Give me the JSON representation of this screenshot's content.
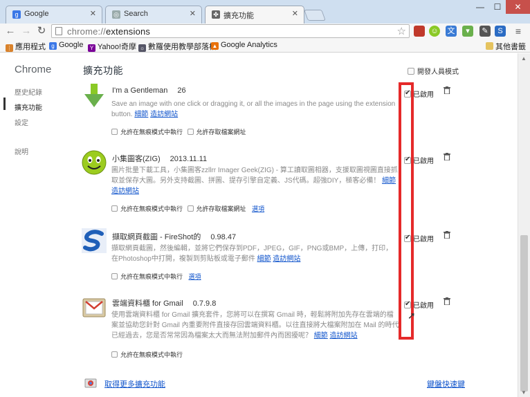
{
  "tabs": [
    {
      "title": "Google",
      "icon": "google-g-icon",
      "color": "#3b78e7"
    },
    {
      "title": "Search",
      "icon": "search-icon",
      "color": "#888888"
    },
    {
      "title": "擴充功能",
      "icon": "puzzle-icon",
      "color": "#555555"
    }
  ],
  "window_controls": {
    "minimize": "—",
    "maximize": "☐",
    "close": "✕"
  },
  "toolbar": {
    "url_scheme": "chrome://",
    "url_path": "extensions"
  },
  "bookmarks": [
    {
      "label": "應用程式",
      "icon": "apps-grid-icon"
    },
    {
      "label": "Google",
      "icon": "google-icon"
    },
    {
      "label": "Yahoo!奇摩",
      "icon": "yahoo-icon"
    },
    {
      "label": "數羅使用教學部落格",
      "icon": "blog-icon"
    },
    {
      "label": "Google Analytics",
      "icon": "analytics-icon"
    }
  ],
  "other_bookmarks": "其他書籤",
  "sidebar": {
    "brand": "Chrome",
    "items": [
      {
        "label": "歷史紀錄"
      },
      {
        "label": "擴充功能"
      },
      {
        "label": "設定"
      },
      {
        "label": "說明"
      }
    ]
  },
  "page": {
    "title": "擴充功能",
    "developer_mode": "開發人員模式"
  },
  "extensions": [
    {
      "name": "I'm a Gentleman",
      "version": "26",
      "description": "Save an image with one click or dragging it, or all the images in the page using the extension button.",
      "links": [
        "細節",
        "造訪網站"
      ],
      "options": [
        "允許在無痕模式中執行",
        "允許存取檔案網址"
      ],
      "enabled_label": "已啟用"
    },
    {
      "name": "小集圖客(ZIG)",
      "version": "2013.11.11",
      "description": "圖片批量下載工具，小集圖客zzllrr Imager Geek(ZIG) - 算工讀取圖相器，支援取圖視圖直接抓取並保存大圖。另外支持截圖、拼圖、提存引擎自定義、JS代碼。超強DIY，極客必備！",
      "links": [
        "細節",
        "造訪網站"
      ],
      "options": [
        "允許在無痕模式中執行",
        "允許存取檔案網址"
      ],
      "extra_link": "選項",
      "enabled_label": "已啟用"
    },
    {
      "name": "擷取網頁截圖 - FireShot的",
      "version": "0.98.47",
      "description": "擷取網頁截圖，然後編輯，並將它們保存到PDF，JPEG，GIF，PNG或BMP，上傳，打印，在Photoshop中打開，複製到剪貼板或電子郵件",
      "links": [
        "細節",
        "造訪網站"
      ],
      "options": [
        "允許在無痕模式中執行"
      ],
      "extra_link": "選項",
      "enabled_label": "已啟用"
    },
    {
      "name": "雲端資料櫃 for Gmail",
      "version": "0.7.9.8",
      "description": "使用雲端資料櫃 for Gmail 擴充套件，您將可以在撰寫 Gmail 時，輕鬆將附加先存在雲端的檔案並協助您針對 Gmail 內重要附件直接存回雲端資料櫃。以往直接將大檔案附加在 Mail 的時代已經過去，您是否常常因為檔案太大而無法附加郵件內而困擾呢？",
      "links": [
        "細節",
        "造訪網站"
      ],
      "options": [
        "允許在無痕模式中執行"
      ],
      "enabled_label": "已啟用"
    }
  ],
  "footer": {
    "get_more": "取得更多擴充功能",
    "shortcuts": "鍵盤快速鍵"
  },
  "accent_colors": {
    "highlight_box": "#e52a2a",
    "link": "#1155cc"
  }
}
